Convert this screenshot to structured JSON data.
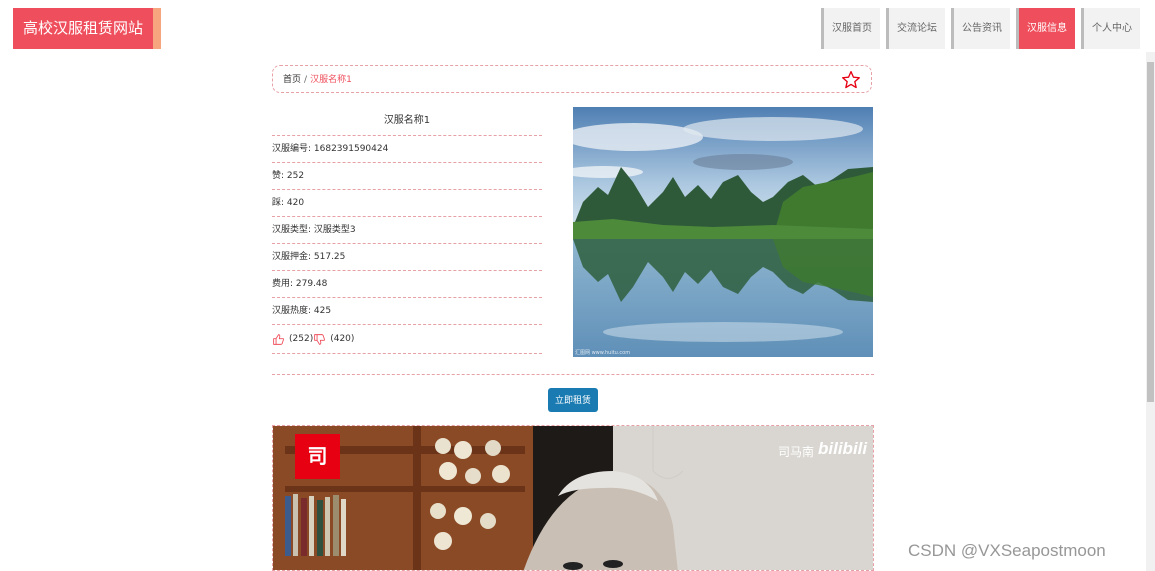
{
  "header": {
    "site_title": "高校汉服租赁网站",
    "nav": [
      "汉服首页",
      "交流论坛",
      "公告资讯",
      "汉服信息",
      "个人中心"
    ],
    "active_nav": "汉服信息",
    "accent_color": "#ef4f5c"
  },
  "breadcrumb": {
    "home": "首页",
    "separator": "/",
    "current": "汉服名称1"
  },
  "details": {
    "title": "汉服名称1",
    "rows": [
      "汉服编号: 1682391590424",
      "赞: 252",
      "踩: 420",
      "汉服类型: 汉服类型3",
      "汉服押金: 517.25",
      "费用: 279.48",
      "汉服热度: 425"
    ],
    "like_count": "(252)",
    "dislike_count": "(420)",
    "icons": [
      "thumb-up-icon",
      "thumb-down-icon",
      "star-icon"
    ]
  },
  "photo": {
    "caption": "汇图网 www.huitu.com"
  },
  "actions": {
    "rent_label": "立即租赁",
    "button_color": "#1a7bb3"
  },
  "video": {
    "uploader": "司马南",
    "platform": "bilibili",
    "logo_char": "司"
  },
  "watermark": "CSDN @VXSeapostmoon"
}
